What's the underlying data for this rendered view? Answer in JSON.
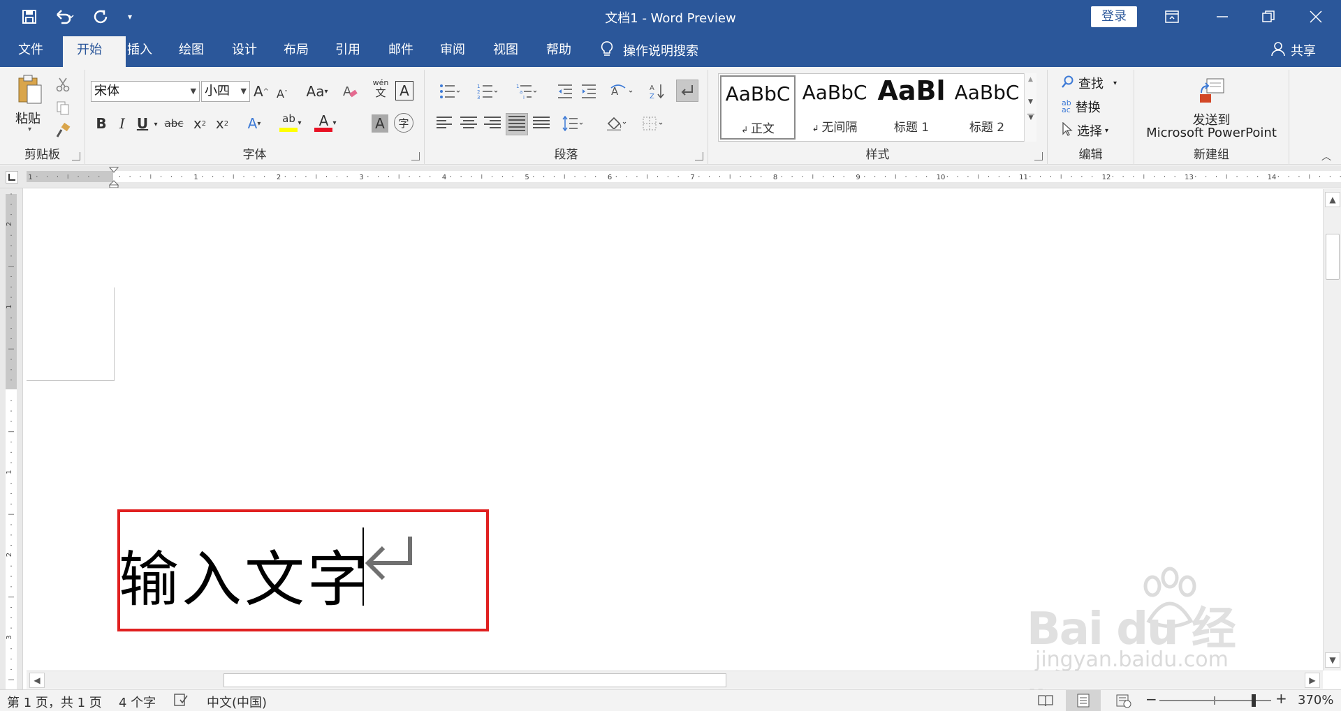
{
  "window": {
    "title": "文档1  -  Word Preview",
    "login_label": "登录",
    "icons": [
      "save-icon",
      "undo-icon",
      "redo-icon",
      "customize-qat-icon",
      "ribbon-display-icon",
      "minimize-icon",
      "restore-icon",
      "close-icon"
    ]
  },
  "tabs": [
    {
      "label": "文件"
    },
    {
      "label": "开始"
    },
    {
      "label": "插入"
    },
    {
      "label": "绘图"
    },
    {
      "label": "设计"
    },
    {
      "label": "布局"
    },
    {
      "label": "引用"
    },
    {
      "label": "邮件"
    },
    {
      "label": "审阅"
    },
    {
      "label": "视图"
    },
    {
      "label": "帮助"
    }
  ],
  "active_tab": "开始",
  "tell_me_label": "操作说明搜索",
  "share_label": "共享",
  "ribbon": {
    "clipboard": {
      "paste_label": "粘贴",
      "group_label": "剪贴板"
    },
    "font": {
      "font_name": "宋体",
      "font_size": "小四",
      "change_case_label": "Aa",
      "grow_label": "A",
      "shrink_label": "A",
      "phonetic_top": "wén",
      "phonetic_bottom": "文",
      "border_char": "A",
      "bold": "B",
      "italic": "I",
      "underline": "U",
      "strike": "abc",
      "subscript": "x",
      "sub_mark": "2",
      "superscript": "x",
      "sup_mark": "2",
      "text_effect": "A",
      "highlight": "ab",
      "font_color": "A",
      "char_shading": "A",
      "enclose": "字",
      "group_label": "字体"
    },
    "paragraph": {
      "group_label": "段落"
    },
    "styles": {
      "items": [
        {
          "sample": "AaBbC",
          "name": "正文"
        },
        {
          "sample": "AaBbC",
          "name": "无间隔"
        },
        {
          "sample": "AaBl",
          "name": "标题 1"
        },
        {
          "sample": "AaBbC",
          "name": "标题 2"
        }
      ],
      "group_label": "样式"
    },
    "editing": {
      "find_label": "查找",
      "replace_label": "替换",
      "select_label": "选择",
      "group_label": "编辑"
    },
    "new_group": {
      "send_label_1": "发送到",
      "send_label_2": "Microsoft PowerPoint",
      "group_label": "新建组"
    }
  },
  "ruler": {
    "h_numbers": [
      "1",
      "1",
      "2",
      "3",
      "4",
      "5",
      "6",
      "7",
      "8",
      "9",
      "10",
      "11",
      "12",
      "13",
      "14"
    ],
    "v_numbers": [
      "2",
      "1",
      "1",
      "2",
      "3"
    ]
  },
  "document": {
    "text": "输入文字",
    "para_mark": "↵"
  },
  "status": {
    "page": "第 1 页，共 1 页",
    "words": "4 个字",
    "language": "中文(中国)",
    "zoom": "370%",
    "zoom_minus": "−",
    "zoom_plus": "+"
  },
  "watermark": {
    "main": "Bai du 经验",
    "sub": "jingyan.baidu.com"
  },
  "colors": {
    "brand": "#2b579a",
    "ribbon_bg": "#f3f3f3",
    "highlight_box": "#e02020"
  }
}
